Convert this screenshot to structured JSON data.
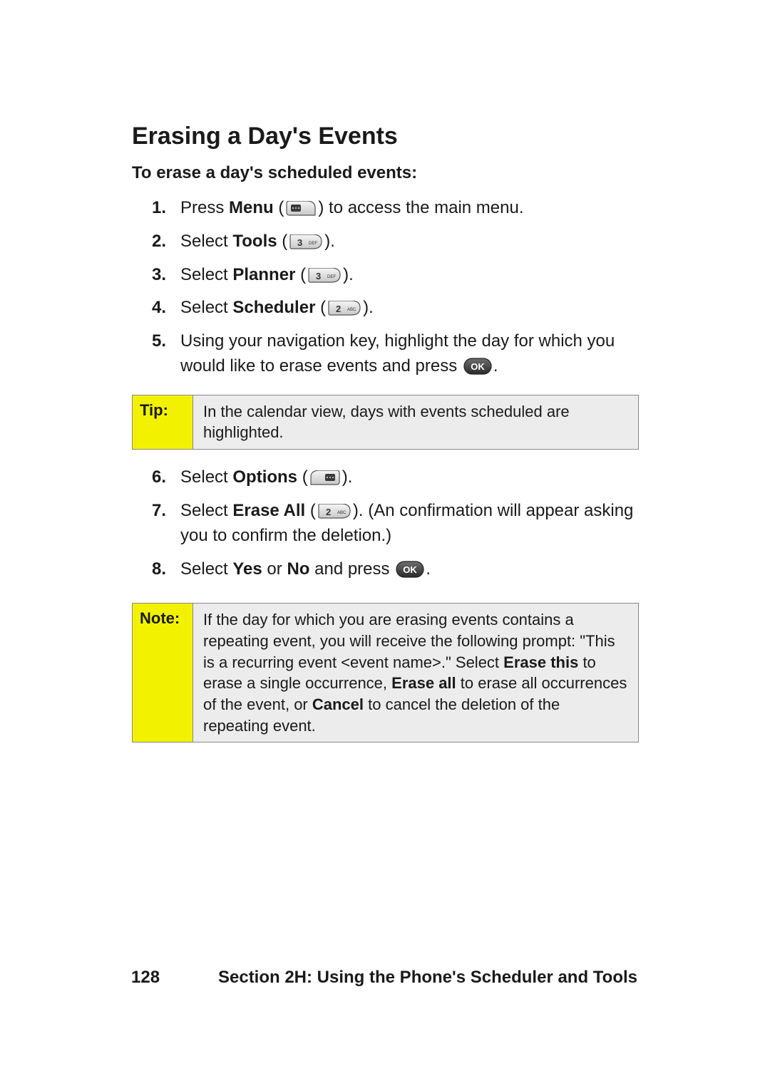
{
  "title": "Erasing a Day's Events",
  "subhead": "To erase a day's scheduled events:",
  "steps": {
    "s1a": "Press ",
    "s1b": "Menu",
    "s1c": " (",
    "s1d": ") to access the main menu.",
    "s2a": "Select ",
    "s2b": "Tools",
    "s2c": " (",
    "s2d": ").",
    "s3a": "Select ",
    "s3b": "Planner",
    "s3c": " (",
    "s3d": ").",
    "s4a": "Select ",
    "s4b": "Scheduler",
    "s4c": " (",
    "s4d": ").",
    "s5a": "Using your navigation key, highlight the day for which you would like to erase events and press ",
    "s5b": ".",
    "s6a": "Select ",
    "s6b": "Options",
    "s6c": " (",
    "s6d": ").",
    "s7a": "Select ",
    "s7b": "Erase All",
    "s7c": " (",
    "s7d": "). (An confirmation will appear asking you to confirm the deletion.)",
    "s8a": "Select ",
    "s8b": "Yes",
    "s8c": " or ",
    "s8d": "No",
    "s8e": " and press ",
    "s8f": "."
  },
  "tip": {
    "label": "Tip:",
    "body": "In the calendar view, days with events scheduled are highlighted."
  },
  "note": {
    "label": "Note:",
    "pre": "If the day for which you are erasing events contains a repeating event, you will receive the following prompt: \"This is a recurring event <event name>.\" Select ",
    "b1": "Erase this",
    "mid1": " to erase a single occurrence, ",
    "b2": "Erase all",
    "mid2": " to erase all occurrences of the event, or ",
    "b3": "Cancel",
    "post": " to cancel the deletion of the repeating event."
  },
  "footer": {
    "page": "128",
    "section": "Section 2H: Using the Phone's Scheduler and Tools"
  },
  "keys": {
    "three_def": "3 DEF",
    "two_abc": "2 ABC"
  }
}
